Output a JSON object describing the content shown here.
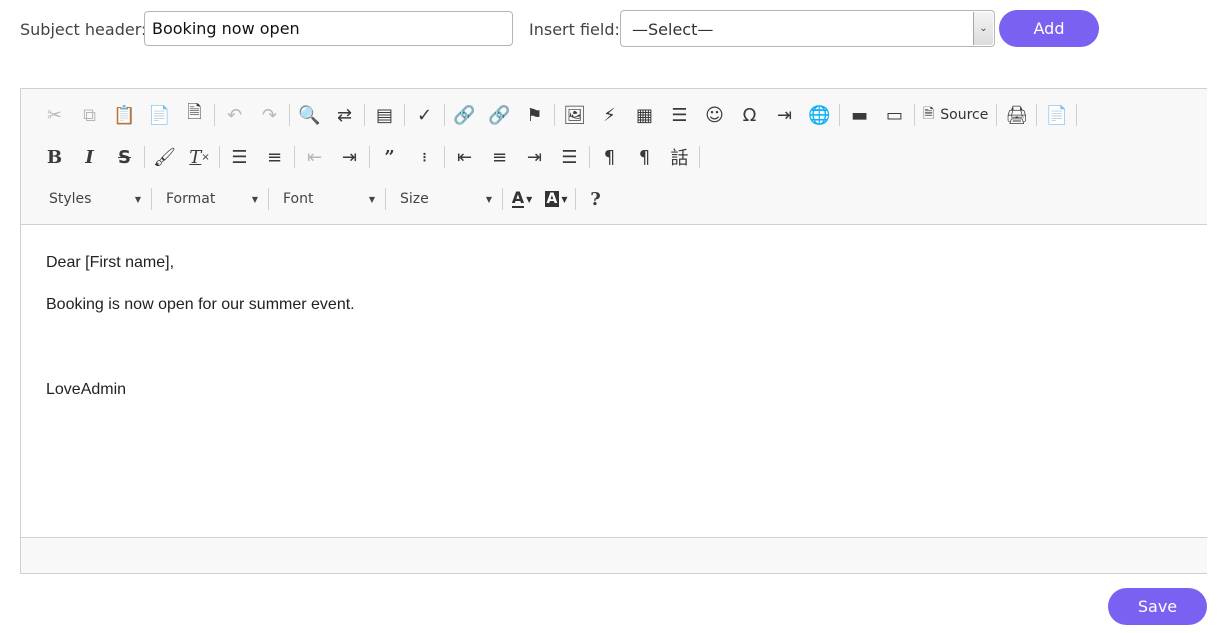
{
  "form": {
    "subject_label": "Subject header:",
    "subject_value": "Booking now open",
    "insert_label": "Insert field:",
    "insert_selected": "—Select—",
    "add_label": "Add"
  },
  "toolbar": {
    "source_label": "Source",
    "styles_label": "Styles",
    "format_label": "Format",
    "font_label": "Font",
    "size_label": "Size",
    "help_label": "?",
    "bold_label": "B",
    "italic_label": "I",
    "strike_label": "S",
    "text_color_letter": "A",
    "bg_color_letter": "A"
  },
  "editor_content": {
    "line1": "Dear [First name],",
    "line2": "Booking is now open for our summer event.",
    "line3": "LoveAdmin"
  },
  "actions": {
    "save_label": "Save"
  },
  "colors": {
    "accent": "#7b61f2",
    "toolbar_bg": "#f8f8f8",
    "border": "#d1d1d1"
  }
}
